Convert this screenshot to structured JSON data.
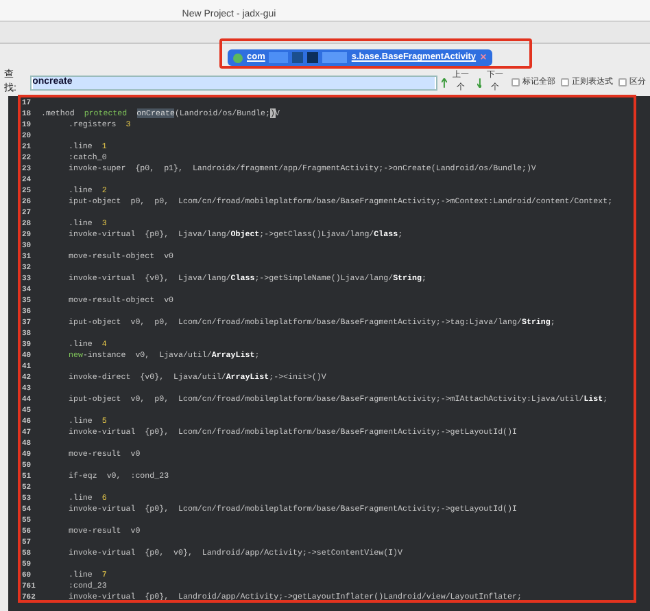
{
  "window": {
    "title": "New Project - jadx-gui"
  },
  "tabs": [
    {
      "label_start": "com",
      "label_end": "s.base.BaseFragmentActivity",
      "close": "×",
      "selected": true
    }
  ],
  "search": {
    "label": "查找:",
    "value": "oncreate",
    "prev": "上一个",
    "next": "下一个",
    "options": [
      {
        "label": "标记全部",
        "checked": false
      },
      {
        "label": "正则表达式",
        "checked": false
      },
      {
        "label": "区分",
        "checked": false
      }
    ]
  },
  "code": [
    {
      "number": "17"
    },
    {
      "number": "18",
      "indented": false,
      "tokens": [
        {
          "kind": "plain",
          "text": ".method  "
        },
        {
          "kind": "keyword",
          "text": "protected  "
        },
        {
          "kind": "match",
          "text": "onCreate"
        },
        {
          "kind": "plain",
          "text": "(Landroid/os/Bundle;"
        },
        {
          "kind": "bracket",
          "text": ")"
        },
        {
          "kind": "plain",
          "text": "V"
        }
      ]
    },
    {
      "number": "19",
      "indented": true,
      "tokens": [
        {
          "kind": "plain",
          "text": ".registers  "
        },
        {
          "kind": "number",
          "text": "3"
        }
      ]
    },
    {
      "number": "20"
    },
    {
      "number": "21",
      "indented": true,
      "tokens": [
        {
          "kind": "plain",
          "text": ".line  "
        },
        {
          "kind": "number",
          "text": "1"
        }
      ]
    },
    {
      "number": "22",
      "indented": true,
      "tokens": [
        {
          "kind": "plain",
          "text": ":catch_0"
        }
      ]
    },
    {
      "number": "23",
      "indented": true,
      "tokens": [
        {
          "kind": "plain",
          "text": "invoke-super  {p0,  p1},  Landroidx/fragment/app/FragmentActivity;->onCreate(Landroid/os/Bundle;)V"
        }
      ]
    },
    {
      "number": "24"
    },
    {
      "number": "25",
      "indented": true,
      "tokens": [
        {
          "kind": "plain",
          "text": ".line  "
        },
        {
          "kind": "number",
          "text": "2"
        }
      ]
    },
    {
      "number": "26",
      "indented": true,
      "tokens": [
        {
          "kind": "plain",
          "text": "iput-object  p0,  p0,  Lcom/cn/froad/mobileplatform/base/BaseFragmentActivity;->mContext:Landroid/content/Context;"
        }
      ]
    },
    {
      "number": "27"
    },
    {
      "number": "28",
      "indented": true,
      "tokens": [
        {
          "kind": "plain",
          "text": ".line  "
        },
        {
          "kind": "number",
          "text": "3"
        }
      ]
    },
    {
      "number": "29",
      "indented": true,
      "tokens": [
        {
          "kind": "plain",
          "text": "invoke-virtual  {p0},  Ljava/lang/"
        },
        {
          "kind": "type",
          "text": "Object"
        },
        {
          "kind": "plain",
          "text": ";->getClass()Ljava/lang/"
        },
        {
          "kind": "type",
          "text": "Class"
        },
        {
          "kind": "plain",
          "text": ";"
        }
      ]
    },
    {
      "number": "30"
    },
    {
      "number": "31",
      "indented": true,
      "tokens": [
        {
          "kind": "plain",
          "text": "move-result-object  v0"
        }
      ]
    },
    {
      "number": "32"
    },
    {
      "number": "33",
      "indented": true,
      "tokens": [
        {
          "kind": "plain",
          "text": "invoke-virtual  {v0},  Ljava/lang/"
        },
        {
          "kind": "type",
          "text": "Class"
        },
        {
          "kind": "plain",
          "text": ";->getSimpleName()Ljava/lang/"
        },
        {
          "kind": "type",
          "text": "String"
        },
        {
          "kind": "plain",
          "text": ";"
        }
      ]
    },
    {
      "number": "34"
    },
    {
      "number": "35",
      "indented": true,
      "tokens": [
        {
          "kind": "plain",
          "text": "move-result-object  v0"
        }
      ]
    },
    {
      "number": "36"
    },
    {
      "number": "37",
      "indented": true,
      "tokens": [
        {
          "kind": "plain",
          "text": "iput-object  v0,  p0,  Lcom/cn/froad/mobileplatform/base/BaseFragmentActivity;->tag:Ljava/lang/"
        },
        {
          "kind": "type",
          "text": "String"
        },
        {
          "kind": "plain",
          "text": ";"
        }
      ]
    },
    {
      "number": "38"
    },
    {
      "number": "39",
      "indented": true,
      "tokens": [
        {
          "kind": "plain",
          "text": ".line  "
        },
        {
          "kind": "number",
          "text": "4"
        }
      ]
    },
    {
      "number": "40",
      "indented": true,
      "tokens": [
        {
          "kind": "keyword",
          "text": "new"
        },
        {
          "kind": "plain",
          "text": "-instance  v0,  Ljava/util/"
        },
        {
          "kind": "type",
          "text": "ArrayList"
        },
        {
          "kind": "plain",
          "text": ";"
        }
      ]
    },
    {
      "number": "41"
    },
    {
      "number": "42",
      "indented": true,
      "tokens": [
        {
          "kind": "plain",
          "text": "invoke-direct  {v0},  Ljava/util/"
        },
        {
          "kind": "type",
          "text": "ArrayList"
        },
        {
          "kind": "plain",
          "text": ";-><init>()V"
        }
      ]
    },
    {
      "number": "43"
    },
    {
      "number": "44",
      "indented": true,
      "tokens": [
        {
          "kind": "plain",
          "text": "iput-object  v0,  p0,  Lcom/cn/froad/mobileplatform/base/BaseFragmentActivity;->mIAttachActivity:Ljava/util/"
        },
        {
          "kind": "type",
          "text": "List"
        },
        {
          "kind": "plain",
          "text": ";"
        }
      ]
    },
    {
      "number": "45"
    },
    {
      "number": "46",
      "indented": true,
      "tokens": [
        {
          "kind": "plain",
          "text": ".line  "
        },
        {
          "kind": "number",
          "text": "5"
        }
      ]
    },
    {
      "number": "47",
      "indented": true,
      "tokens": [
        {
          "kind": "plain",
          "text": "invoke-virtual  {p0},  Lcom/cn/froad/mobileplatform/base/BaseFragmentActivity;->getLayoutId()I"
        }
      ]
    },
    {
      "number": "48"
    },
    {
      "number": "49",
      "indented": true,
      "tokens": [
        {
          "kind": "plain",
          "text": "move-result  v0"
        }
      ]
    },
    {
      "number": "50"
    },
    {
      "number": "51",
      "indented": true,
      "tokens": [
        {
          "kind": "plain",
          "text": "if-eqz  v0,  :cond_23"
        }
      ]
    },
    {
      "number": "52"
    },
    {
      "number": "53",
      "indented": true,
      "tokens": [
        {
          "kind": "plain",
          "text": ".line  "
        },
        {
          "kind": "number",
          "text": "6"
        }
      ]
    },
    {
      "number": "54",
      "indented": true,
      "tokens": [
        {
          "kind": "plain",
          "text": "invoke-virtual  {p0},  Lcom/cn/froad/mobileplatform/base/BaseFragmentActivity;->getLayoutId()I"
        }
      ]
    },
    {
      "number": "55"
    },
    {
      "number": "56",
      "indented": true,
      "tokens": [
        {
          "kind": "plain",
          "text": "move-result  v0"
        }
      ]
    },
    {
      "number": "57"
    },
    {
      "number": "58",
      "indented": true,
      "tokens": [
        {
          "kind": "plain",
          "text": "invoke-virtual  {p0,  v0},  Landroid/app/Activity;->setContentView(I)V"
        }
      ]
    },
    {
      "number": "59"
    },
    {
      "number": "60",
      "indented": true,
      "tokens": [
        {
          "kind": "plain",
          "text": ".line  "
        },
        {
          "kind": "number",
          "text": "7"
        }
      ]
    },
    {
      "number": "761",
      "indented": true,
      "tokens": [
        {
          "kind": "plain",
          "text": ":cond_23"
        }
      ]
    },
    {
      "number": "762",
      "indented": true,
      "tokens": [
        {
          "kind": "plain",
          "text": "invoke-virtual  {p0},  Landroid/app/Activity;->getLayoutInflater()Landroid/view/LayoutInflater;"
        }
      ]
    }
  ]
}
